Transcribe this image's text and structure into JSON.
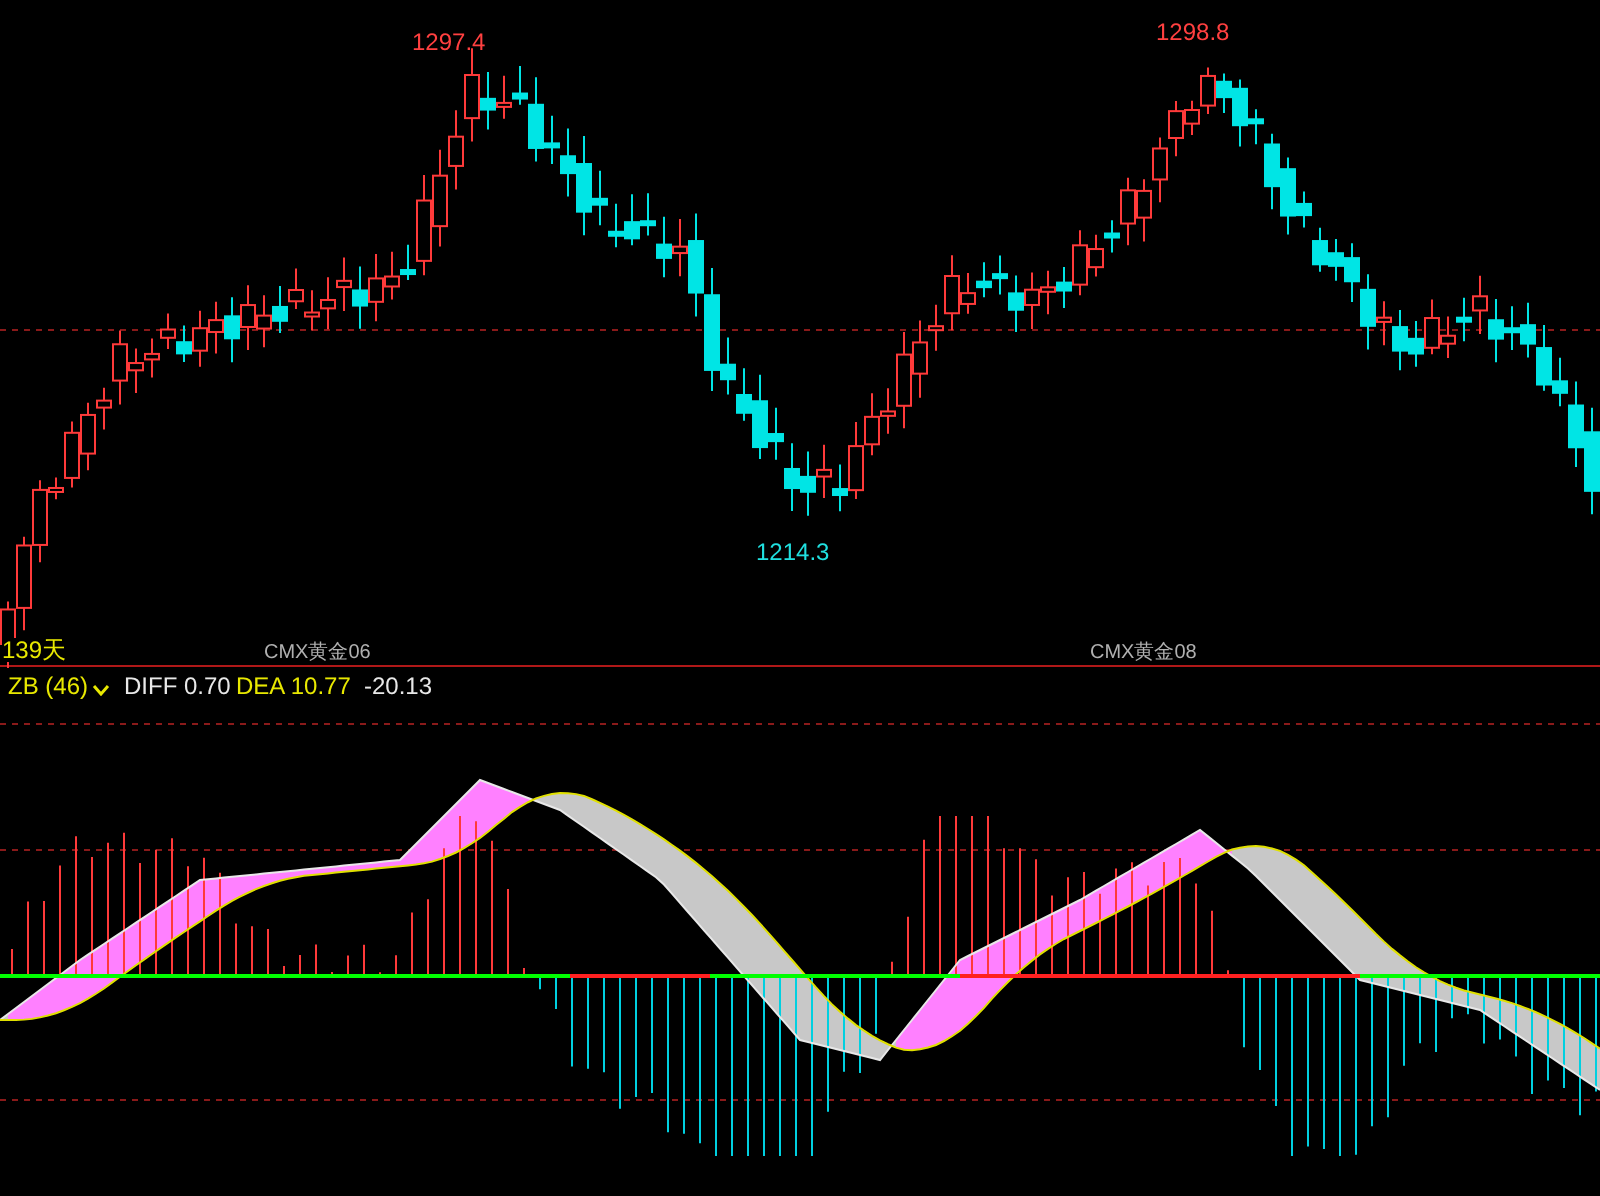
{
  "price_panel": {
    "annotations": [
      {
        "text": "1297.4",
        "kind": "high"
      },
      {
        "text": "1298.8",
        "kind": "high"
      },
      {
        "text": "1214.3",
        "kind": "low"
      }
    ],
    "period": "139天",
    "contract_labels": [
      "CMX黄金06",
      "CMX黄金08"
    ]
  },
  "indicator_panel": {
    "name": "ZB (46)",
    "diff": "DIFF 0.70",
    "dea": "DEA 10.77",
    "macd": "-20.13"
  }
}
